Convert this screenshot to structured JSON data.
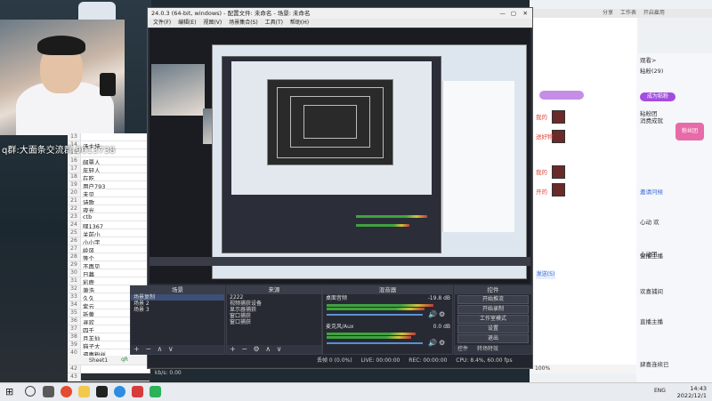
{
  "obs": {
    "title": "24.0.3 (64-bit, windows) - 配置文件: 未命名 - 场景: 未命名",
    "menu": [
      "文件(F)",
      "编辑(E)",
      "视图(V)",
      "场景集合(S)",
      "工具(T)",
      "帮助(H)"
    ],
    "docks": {
      "scenes": {
        "title": "场景",
        "items": [
          "场景复制",
          "场景 2",
          "场景 3"
        ]
      },
      "sources": {
        "title": "来源",
        "items": [
          "2222",
          "视频捕获设备",
          "显示器捕获",
          "窗口捕获",
          "窗口捕获"
        ]
      },
      "mixer": {
        "title": "混音器",
        "tracks": [
          {
            "name": "桌面音频",
            "level": "-19.8 dB"
          },
          {
            "name": "麦克风/Aux",
            "level": "0.0 dB"
          }
        ]
      },
      "controls": {
        "title": "控件",
        "buttons": [
          "开始推流",
          "开始录制",
          "工作室模式",
          "设置",
          "退出"
        ]
      }
    },
    "dock_footer_tabs": [
      "控件",
      "转场特效"
    ],
    "status": {
      "dropped": "丢帧 0 (0.0%)",
      "live": "LIVE: 00:00:00",
      "rec": "REC: 00:00:00",
      "cpu": "CPU: 8.4%, 60.00 fps",
      "kbps": "kb/s: 0.00"
    }
  },
  "spreadsheet": {
    "rows": [
      {
        "num": "13",
        "text": ""
      },
      {
        "num": "14",
        "text": "汤主持"
      },
      {
        "num": "15",
        "text": ""
      },
      {
        "num": "16",
        "text": "邮票人"
      },
      {
        "num": "17",
        "text": "年轻人"
      },
      {
        "num": "18",
        "text": "在吃"
      },
      {
        "num": "19",
        "text": "用户793"
      },
      {
        "num": "20",
        "text": "未见"
      },
      {
        "num": "21",
        "text": "诗歌"
      },
      {
        "num": "22",
        "text": "夜光"
      },
      {
        "num": "23",
        "text": "ctb"
      },
      {
        "num": "24",
        "text": "嘿1367"
      },
      {
        "num": "25",
        "text": "关前小"
      },
      {
        "num": "26",
        "text": "小小宇"
      },
      {
        "num": "27",
        "text": "岭风"
      },
      {
        "num": "28",
        "text": "等个"
      },
      {
        "num": "29",
        "text": "不再见"
      },
      {
        "num": "30",
        "text": "日暮"
      },
      {
        "num": "31",
        "text": "彩鹿"
      },
      {
        "num": "32",
        "text": "萧浩"
      },
      {
        "num": "33",
        "text": "久久"
      },
      {
        "num": "34",
        "text": "紫云"
      },
      {
        "num": "35",
        "text": "祈黄"
      },
      {
        "num": "36",
        "text": "寻欢"
      },
      {
        "num": "37",
        "text": "四千"
      },
      {
        "num": "38",
        "text": "且羊仙"
      },
      {
        "num": "39",
        "text": "猫子大"
      },
      {
        "num": "40",
        "text": "逼惠粉丝"
      },
      {
        "num": "41",
        "text": ""
      },
      {
        "num": "42",
        "text": ""
      },
      {
        "num": "43",
        "text": ""
      }
    ],
    "sheet_tab": "Sheet1",
    "sheet_tab2": "qR"
  },
  "overlay": {
    "qq_text": "q群:大面条交流群 9013738"
  },
  "chat": {
    "tabs": [
      "分享"
    ],
    "toolbar": [
      "工作表",
      "开启雇用"
    ],
    "right_items": [
      "观看>",
      "粘粉(29)",
      "成为粘粉",
      "粘粉团",
      "消费成就",
      "粉丝团",
      "邀请问候",
      "心动 欢",
      "心动团",
      "直播主播",
      "欢喜捕间",
      "直播主播",
      "肆喜连续已"
    ],
    "messages": [
      "我的",
      "送好物",
      "我的",
      "开的",
      "开业",
      "发送(S)"
    ],
    "zoom": "100%"
  },
  "taskbar": {
    "time": "14:43",
    "date": "2022/12/1",
    "lang": "ENG"
  }
}
